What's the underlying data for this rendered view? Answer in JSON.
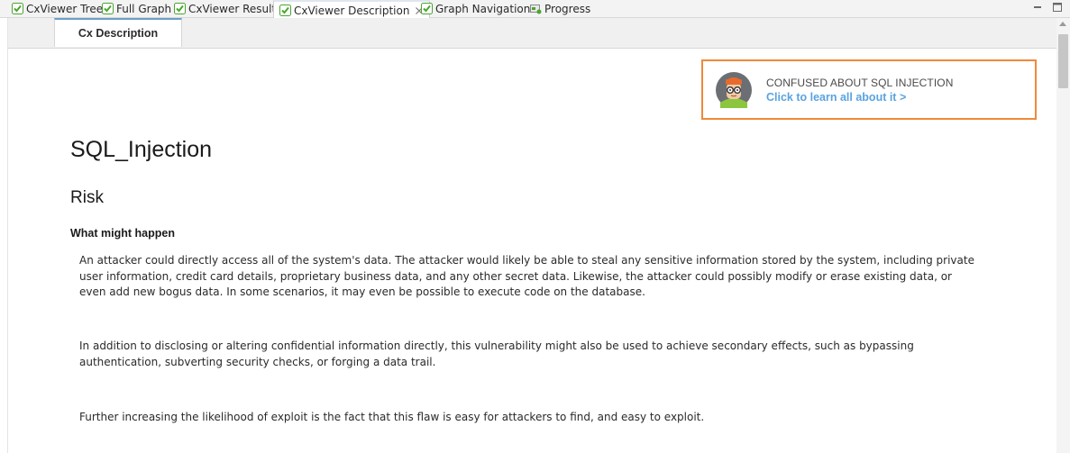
{
  "tabs": [
    {
      "label": "CxViewer Tree",
      "icon": "checkmark-icon"
    },
    {
      "label": "Full Graph",
      "icon": "checkmark-icon"
    },
    {
      "label": "CxViewer Results",
      "icon": "checkmark-icon"
    },
    {
      "label": "CxViewer Description",
      "icon": "checkmark-icon",
      "active": true,
      "closable": true
    },
    {
      "label": "Graph Navigation",
      "icon": "checkmark-icon"
    },
    {
      "label": "Progress",
      "icon": "progress-icon"
    }
  ],
  "subtab": {
    "label": "Cx Description"
  },
  "promo": {
    "title": "CONFUSED ABOUT SQL INJECTION",
    "link": "Click to learn all about it >"
  },
  "content": {
    "title": "SQL_Injection",
    "section": "Risk",
    "subsection": "What might happen",
    "paragraphs": [
      "An attacker could directly access all of the system's data. The attacker would likely be able to steal any sensitive information stored by the system, including private user information, credit card details, proprietary business data, and any other secret data. Likewise, the attacker could possibly modify or erase existing data, or even add new bogus data. In some scenarios, it may even be possible to execute code on the database.",
      "In addition to disclosing or altering confidential information directly, this vulnerability might also be used to achieve secondary effects, such as bypassing authentication, subverting security checks, or forging a data trail.",
      "Further increasing the likelihood of exploit is the fact that this flaw is easy for attackers to find, and easy to exploit."
    ]
  },
  "colors": {
    "accent_orange": "#f0893b",
    "link_blue": "#5aa3e0",
    "tab_check_green": "#4aa52e"
  }
}
